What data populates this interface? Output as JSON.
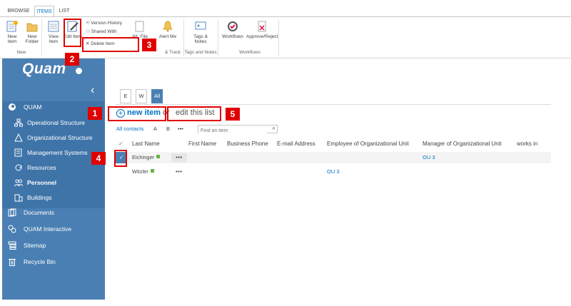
{
  "ribbon_tabs": [
    "BROWSE",
    "ITEMS",
    "LIST"
  ],
  "ribbon": {
    "new_item": "New Item",
    "new_folder": "New Folder",
    "view_item": "View Item",
    "edit_item": "Edit Item",
    "version_history": "Version History",
    "shared_with": "Shared With",
    "delete_item": "Delete Item",
    "attach_file": "Att. File",
    "alert_me": "Alert Me",
    "tags_notes": "Tags & Notes",
    "workflows": "Workflows",
    "approve_reject": "Approve/Reject",
    "group_new": "New",
    "group_share_track": "& Track",
    "group_tags": "Tags and Notes",
    "group_workflows": "Workflows"
  },
  "sidebar": {
    "logo": "Quam",
    "root": "QUAM",
    "items": [
      {
        "label": "Operational Structure",
        "icon": "org-chart-icon"
      },
      {
        "label": "Organizational Structure",
        "icon": "hierarchy-icon"
      },
      {
        "label": "Management Systems",
        "icon": "document-icon"
      },
      {
        "label": "Resources",
        "icon": "sync-icon"
      },
      {
        "label": "Personnel",
        "icon": "people-icon"
      },
      {
        "label": "Buildings",
        "icon": "building-icon"
      }
    ],
    "bottom": [
      {
        "label": "Documents",
        "icon": "documents-icon"
      },
      {
        "label": "QUAM Interactive",
        "icon": "interactive-icon"
      },
      {
        "label": "Sitemap",
        "icon": "sitemap-icon"
      },
      {
        "label": "Recycle Bin",
        "icon": "trash-icon"
      }
    ]
  },
  "view_tabs": [
    "E",
    "W",
    "All"
  ],
  "commands": {
    "new_item_bold": "new item",
    "or": "or",
    "edit_list": "edit this list"
  },
  "viewbar": {
    "all_contacts": "All contacts",
    "a": "A",
    "b": "B",
    "more": "•••",
    "search_placeholder": "Find an item"
  },
  "columns": [
    "Last Name",
    "First Name",
    "Business Phone",
    "E-mail Address",
    "Employee of Organizational Unit",
    "Manager of Organizational Unit",
    "works in"
  ],
  "rows": [
    {
      "last_name": "Eichinger",
      "more": "•••",
      "employee_of": "",
      "manager_of": "OU 3"
    },
    {
      "last_name": "Witzler",
      "more": "•••",
      "employee_of": "OU 3",
      "manager_of": ""
    }
  ],
  "callouts": [
    "1",
    "2",
    "3",
    "4",
    "5"
  ],
  "colors": {
    "accent": "#0072c6",
    "sidebar": "#4a7fb3",
    "callout": "#e00000"
  }
}
